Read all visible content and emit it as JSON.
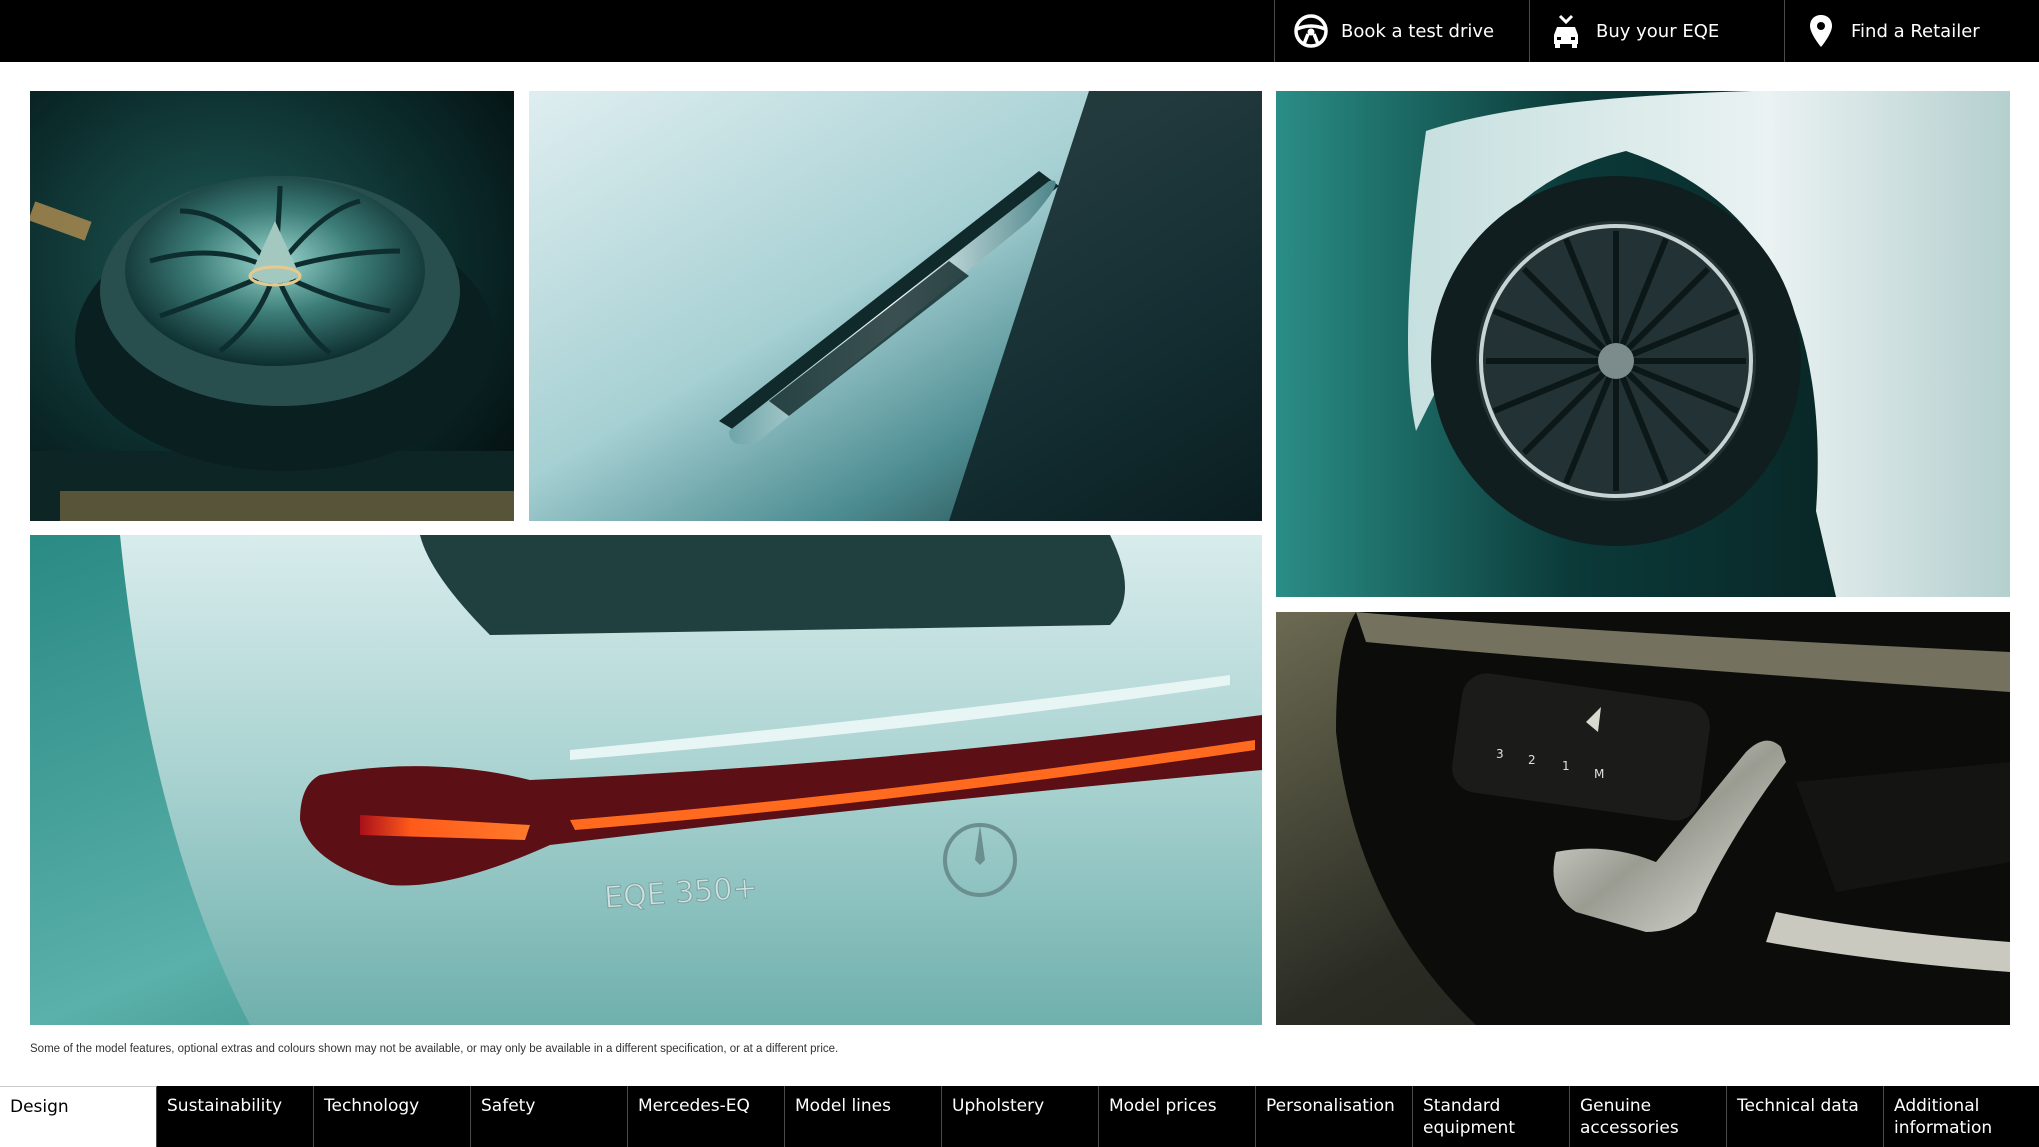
{
  "topbar": {
    "buttons": [
      {
        "label": "Book a test drive",
        "icon": "steering-wheel-icon"
      },
      {
        "label": "Buy your EQE",
        "icon": "car-buy-icon"
      },
      {
        "label": "Find a Retailer",
        "icon": "location-pin-icon"
      }
    ]
  },
  "gallery": {
    "rear_badge": "EQE 350+",
    "seat_buttons": [
      "3",
      "2",
      "1",
      "M"
    ]
  },
  "disclaimer": "Some of the model features, optional extras and colours shown may not be available, or may only be available in a different specification, or at a different price.",
  "bottomnav": {
    "items": [
      {
        "label": "Design",
        "active": true
      },
      {
        "label": "Sustainability"
      },
      {
        "label": "Technology"
      },
      {
        "label": "Safety"
      },
      {
        "label": "Mercedes-EQ"
      },
      {
        "label": "Model lines"
      },
      {
        "label": "Upholstery"
      },
      {
        "label": "Model prices"
      },
      {
        "label": "Personalisation"
      },
      {
        "label": "Standard equipment"
      },
      {
        "label": "Genuine accessories"
      },
      {
        "label": "Technical data"
      },
      {
        "label": "Additional information"
      }
    ]
  }
}
